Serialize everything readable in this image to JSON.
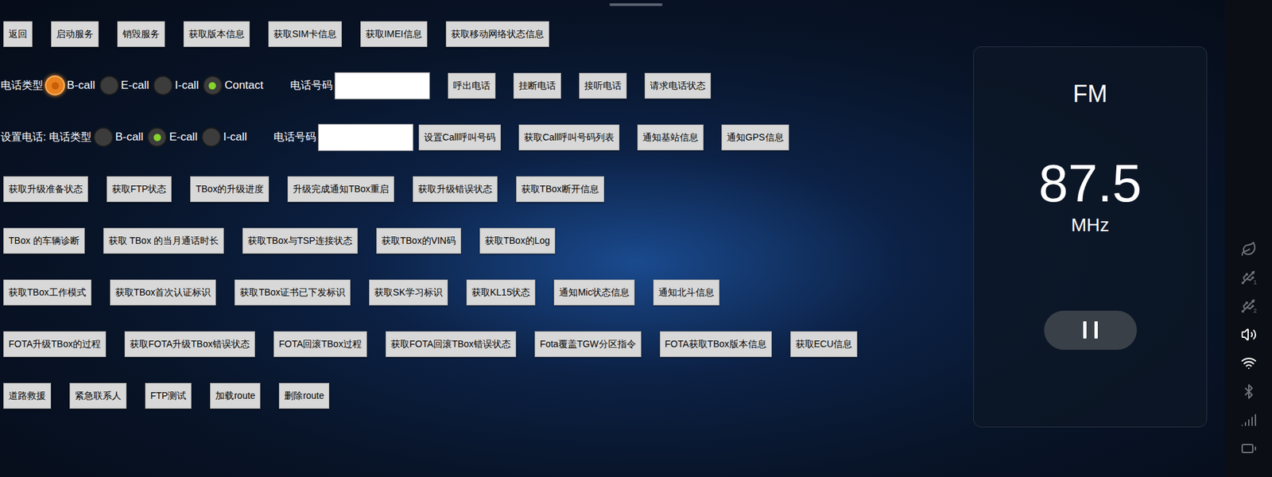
{
  "top_buttons": [
    "返回",
    "启动服务",
    "销毁服务",
    "获取版本信息",
    "获取SIM卡信息",
    "获取IMEI信息",
    "获取移动网络状态信息"
  ],
  "call": {
    "type_label": "电话类型",
    "types": [
      {
        "label": "B-call",
        "selected": false,
        "focused": true
      },
      {
        "label": "E-call",
        "selected": false,
        "focused": false
      },
      {
        "label": "I-call",
        "selected": false,
        "focused": false
      },
      {
        "label": "Contact",
        "selected": true,
        "focused": false
      }
    ],
    "number_label": "电话号码",
    "number_value": "",
    "buttons": [
      "呼出电话",
      "挂断电话",
      "接听电话",
      "请求电话状态"
    ]
  },
  "set_call": {
    "type_label": "设置电话: 电话类型",
    "types": [
      {
        "label": "B-call",
        "selected": false,
        "focused": false
      },
      {
        "label": "E-call",
        "selected": true,
        "focused": false
      },
      {
        "label": "I-call",
        "selected": false,
        "focused": false
      }
    ],
    "number_label": "电话号码",
    "number_value": "",
    "buttons": [
      "设置Call呼叫号码",
      "获取Call呼叫号码列表",
      "通知基站信息",
      "通知GPS信息"
    ]
  },
  "button_rows": [
    [
      "获取升级准备状态",
      "获取FTP状态",
      "TBox的升级进度",
      "升级完成通知TBox重启",
      "获取升级错误状态",
      "获取TBox断开信息"
    ],
    [
      "TBox 的车辆诊断",
      "获取 TBox 的当月通话时长",
      "获取TBox与TSP连接状态",
      "获取TBox的VIN码",
      "获取TBox的Log"
    ],
    [
      "获取TBox工作模式",
      "获取TBox首次认证标识",
      "获取TBox证书已下发标识",
      "获取SK学习标识",
      "获取KL15状态",
      "通知Mic状态信息",
      "通知北斗信息"
    ],
    [
      "FOTA升级TBox的过程",
      "获取FOTA升级TBox错误状态",
      "FOTA回滚TBox过程",
      "获取FOTA回滚TBox错误状态",
      "Fota覆盖TGW分区指令",
      "FOTA获取TBox版本信息",
      "获取ECU信息"
    ],
    [
      "道路救援",
      "紧急联系人",
      "FTP测试",
      "加载route",
      "删除route"
    ]
  ],
  "fm": {
    "band": "FM",
    "frequency": "87.5",
    "unit": "MHz",
    "playing": true
  },
  "status_bar": [
    {
      "kind": "leaf",
      "label": "",
      "highlighted": false
    },
    {
      "kind": "usb",
      "label": "1",
      "highlighted": false
    },
    {
      "kind": "usb",
      "label": "2",
      "highlighted": false
    },
    {
      "kind": "volume",
      "label": "",
      "highlighted": true
    },
    {
      "kind": "wifi",
      "label": "",
      "highlighted": true
    },
    {
      "kind": "bluetooth",
      "label": "",
      "highlighted": false
    },
    {
      "kind": "signal",
      "label": "",
      "highlighted": false
    },
    {
      "kind": "battery",
      "label": "",
      "highlighted": false
    }
  ]
}
